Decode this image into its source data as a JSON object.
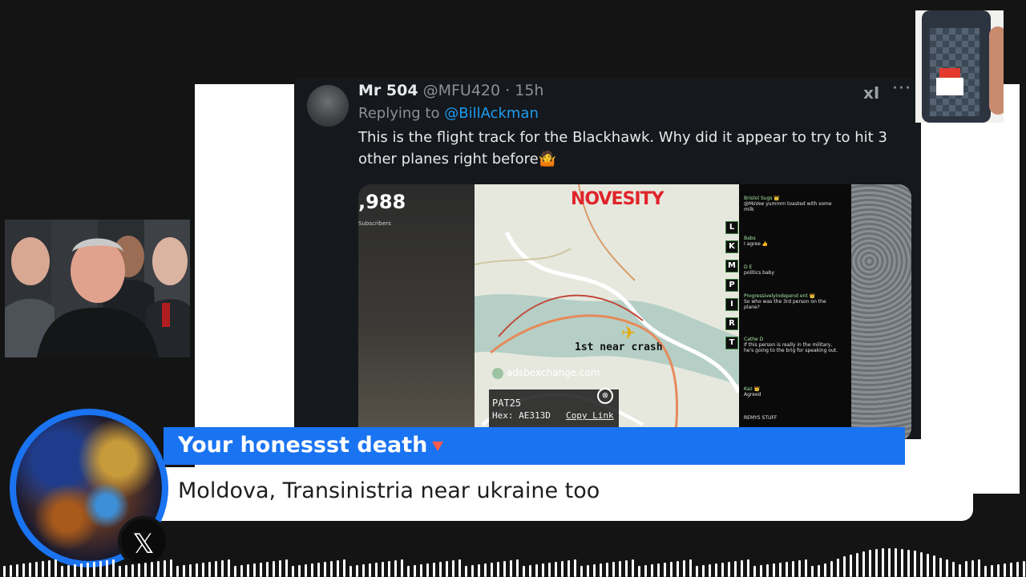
{
  "tweet": {
    "name": "Mr 504",
    "handle": "@MFU420",
    "age": "· 15h",
    "replying_prefix": "Replying to",
    "replying_to": "@BillAckman",
    "text": "This is the flight track for the Blackhawk. Why did it appear to try to hit 3 other planes right before🤷",
    "grok_icon": "xI",
    "more_icon": "···"
  },
  "media": {
    "subscriber_count": ",988",
    "subscriber_label": "Subscribers",
    "brand": "NOVESITY",
    "annotation": "1st near crash",
    "site": "adsbexchange.com",
    "callsign": "PAT25",
    "hex": "Hex: AE313D",
    "copy_link": "Copy Link",
    "close_icon": "⊗",
    "side_tabs": [
      "L",
      "K",
      "M",
      "P",
      "I",
      "R",
      "T"
    ],
    "chat": [
      {
        "user": "Bristol Sugs 👑",
        "text": "@MsVee yummm toasted with some milk"
      },
      {
        "user": "Babs",
        "text": "I agree 👍"
      },
      {
        "user": "D E",
        "text": "politics baby"
      },
      {
        "user": "ProgressivelyIndepend ent 👑",
        "text": "So who was the 3rd person on the plane?"
      },
      {
        "user": "Cathe D",
        "text": "If this person is really in the military, he's going to the brig for speaking out."
      },
      {
        "user": "Kaz 👑",
        "text": "Agreed"
      },
      {
        "user": "",
        "text": "REMYS STUFF"
      }
    ]
  },
  "overlay": {
    "username": "Your honessst death",
    "message": "Moldova, Transinistria near ukraine too",
    "x_logo": "𝕏"
  },
  "colors": {
    "accent_blue": "#1a73f0",
    "link_blue": "#1d9bf0",
    "brand_red": "#e0242a"
  }
}
